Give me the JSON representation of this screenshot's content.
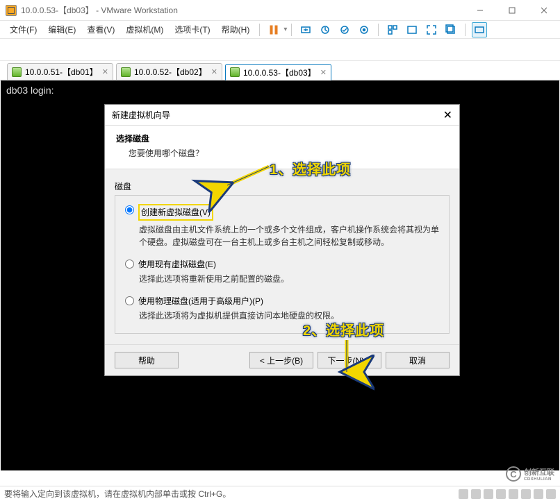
{
  "window": {
    "title": "10.0.0.53-【db03】 - VMware Workstation"
  },
  "menu": {
    "file": "文件(F)",
    "edit": "编辑(E)",
    "view": "查看(V)",
    "vm": "虚拟机(M)",
    "tabs": "选项卡(T)",
    "help": "帮助(H)"
  },
  "tabs": [
    {
      "label": "10.0.0.51-【db01】"
    },
    {
      "label": "10.0.0.52-【db02】"
    },
    {
      "label": "10.0.0.53-【db03】"
    }
  ],
  "console": {
    "text": "db03 login:"
  },
  "dialog": {
    "title": "新建虚拟机向导",
    "heading": "选择磁盘",
    "subheading": "您要使用哪个磁盘？",
    "group": "磁盘",
    "opt1_label": "创建新虚拟磁盘(V)",
    "opt1_desc": "虚拟磁盘由主机文件系统上的一个或多个文件组成，客户机操作系统会将其视为单个硬盘。虚拟磁盘可在一台主机上或多台主机之间轻松复制或移动。",
    "opt2_label": "使用现有虚拟磁盘(E)",
    "opt2_desc": "选择此选项将重新使用之前配置的磁盘。",
    "opt3_label": "使用物理磁盘(适用于高级用户)(P)",
    "opt3_desc": "选择此选项将为虚拟机提供直接访问本地硬盘的权限。",
    "help": "帮助",
    "back": "< 上一步(B)",
    "next": "下一步(N) >",
    "cancel": "取消"
  },
  "status": {
    "text": "要将输入定向到该虚拟机，请在虚拟机内部单击或按 Ctrl+G。"
  },
  "annotations": {
    "a1": "1、选择此项",
    "a2": "2、选择此项"
  },
  "watermark": {
    "brand": "创新互联",
    "sub": "CDXHULIAN"
  }
}
